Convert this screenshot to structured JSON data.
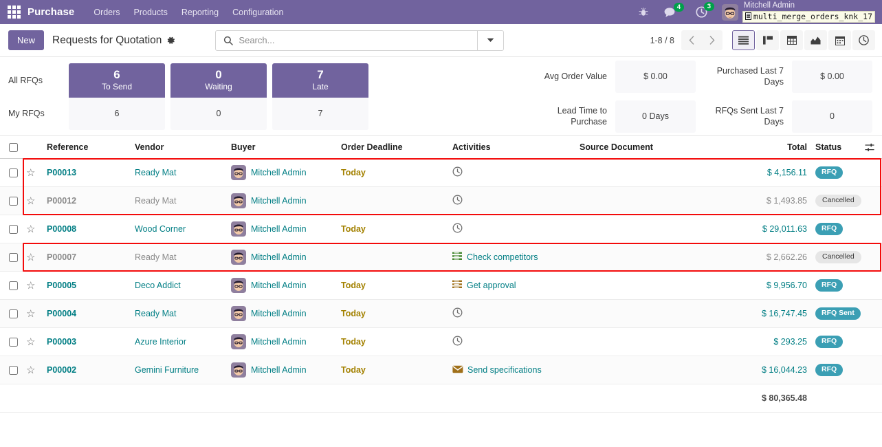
{
  "navbar": {
    "apps_icon": "apps-grid-icon",
    "brand": "Purchase",
    "menus": [
      "Orders",
      "Products",
      "Reporting",
      "Configuration"
    ],
    "bug_icon": "bug-icon",
    "messages_icon": "chat-icon",
    "messages_count": "4",
    "activities_icon": "clock-icon",
    "activities_count": "3",
    "avatar_icon": "user-avatar",
    "user_name": "Mitchell Admin",
    "database_icon": "database-icon",
    "database_name": "multi_merge_orders_knk_17"
  },
  "control_panel": {
    "new_label": "New",
    "title": "Requests for Quotation",
    "gear_icon": "gear-icon",
    "search_icon": "search-icon",
    "search_value": "",
    "search_placeholder": "Search...",
    "dropdown_icon": "caret-down-icon",
    "pager": "1-8 / 8",
    "prev_icon": "chevron-left-icon",
    "next_icon": "chevron-right-icon",
    "views": [
      {
        "name": "list-view",
        "icon": "list-icon",
        "active": true
      },
      {
        "name": "kanban-view",
        "icon": "kanban-icon",
        "active": false
      },
      {
        "name": "pivot-view",
        "icon": "pivot-icon",
        "active": false
      },
      {
        "name": "graph-view",
        "icon": "graph-icon",
        "active": false
      },
      {
        "name": "calendar-view",
        "icon": "calendar-icon",
        "active": false
      },
      {
        "name": "activity-view",
        "icon": "clock-icon",
        "active": false
      }
    ]
  },
  "dashboard": {
    "row_labels": [
      "All RFQs",
      "My RFQs"
    ],
    "columns": [
      {
        "label": "To Send",
        "all": "6",
        "my": "6"
      },
      {
        "label": "Waiting",
        "all": "0",
        "my": "0"
      },
      {
        "label": "Late",
        "all": "7",
        "my": "7"
      }
    ],
    "stats": [
      {
        "label": "Avg Order Value",
        "value": "$ 0.00"
      },
      {
        "label": "Lead Time to Purchase",
        "value": "0 Days"
      },
      {
        "label": "Purchased Last 7 Days",
        "value": "$ 0.00"
      },
      {
        "label": "RFQs Sent Last 7 Days",
        "value": "0"
      }
    ]
  },
  "table": {
    "headers": {
      "reference": "Reference",
      "vendor": "Vendor",
      "buyer": "Buyer",
      "order_deadline": "Order Deadline",
      "activities": "Activities",
      "source_document": "Source Document",
      "total": "Total",
      "status": "Status",
      "options_icon": "column-options-icon"
    },
    "rows": [
      {
        "reference": "P00013",
        "vendor": "Ready Mat",
        "buyer": "Mitchell Admin",
        "deadline": "Today",
        "activity": "",
        "activity_icon": "clock-icon",
        "source": "",
        "total": "$ 4,156.11",
        "status": "RFQ",
        "status_kind": "rfq",
        "dim": false,
        "highlighted": true
      },
      {
        "reference": "P00012",
        "vendor": "Ready Mat",
        "buyer": "Mitchell Admin",
        "deadline": "",
        "activity": "",
        "activity_icon": "clock-icon",
        "source": "",
        "total": "$ 1,493.85",
        "status": "Cancelled",
        "status_kind": "cancelled",
        "dim": true,
        "highlighted": true
      },
      {
        "reference": "P00008",
        "vendor": "Wood Corner",
        "buyer": "Mitchell Admin",
        "deadline": "Today",
        "activity": "",
        "activity_icon": "clock-icon",
        "source": "",
        "total": "$ 29,011.63",
        "status": "RFQ",
        "status_kind": "rfq",
        "dim": false,
        "highlighted": false
      },
      {
        "reference": "P00007",
        "vendor": "Ready Mat",
        "buyer": "Mitchell Admin",
        "deadline": "",
        "activity": "Check competitors",
        "activity_icon": "task-icon-green",
        "source": "",
        "total": "$ 2,662.26",
        "status": "Cancelled",
        "status_kind": "cancelled",
        "dim": true,
        "highlighted": true
      },
      {
        "reference": "P00005",
        "vendor": "Deco Addict",
        "buyer": "Mitchell Admin",
        "deadline": "Today",
        "activity": "Get approval",
        "activity_icon": "task-icon-orange",
        "source": "",
        "total": "$ 9,956.70",
        "status": "RFQ",
        "status_kind": "rfq",
        "dim": false,
        "highlighted": false
      },
      {
        "reference": "P00004",
        "vendor": "Ready Mat",
        "buyer": "Mitchell Admin",
        "deadline": "Today",
        "activity": "",
        "activity_icon": "clock-icon",
        "source": "",
        "total": "$ 16,747.45",
        "status": "RFQ Sent",
        "status_kind": "sent",
        "dim": false,
        "highlighted": false
      },
      {
        "reference": "P00003",
        "vendor": "Azure Interior",
        "buyer": "Mitchell Admin",
        "deadline": "Today",
        "activity": "",
        "activity_icon": "clock-icon",
        "source": "",
        "total": "$ 293.25",
        "status": "RFQ",
        "status_kind": "rfq",
        "dim": false,
        "highlighted": false
      },
      {
        "reference": "P00002",
        "vendor": "Gemini Furniture",
        "buyer": "Mitchell Admin",
        "deadline": "Today",
        "activity": "Send specifications",
        "activity_icon": "envelope-icon",
        "source": "",
        "total": "$ 16,044.23",
        "status": "RFQ",
        "status_kind": "rfq",
        "dim": false,
        "highlighted": false
      }
    ],
    "footer_total": "$ 80,365.48"
  },
  "colors": {
    "brand_purple": "#71639e",
    "link_teal": "#017e84",
    "badge_teal": "#3b9fb4",
    "deadline_amber": "#a38100",
    "highlight_red": "#f30b0b",
    "badge_green": "#00a04a"
  }
}
